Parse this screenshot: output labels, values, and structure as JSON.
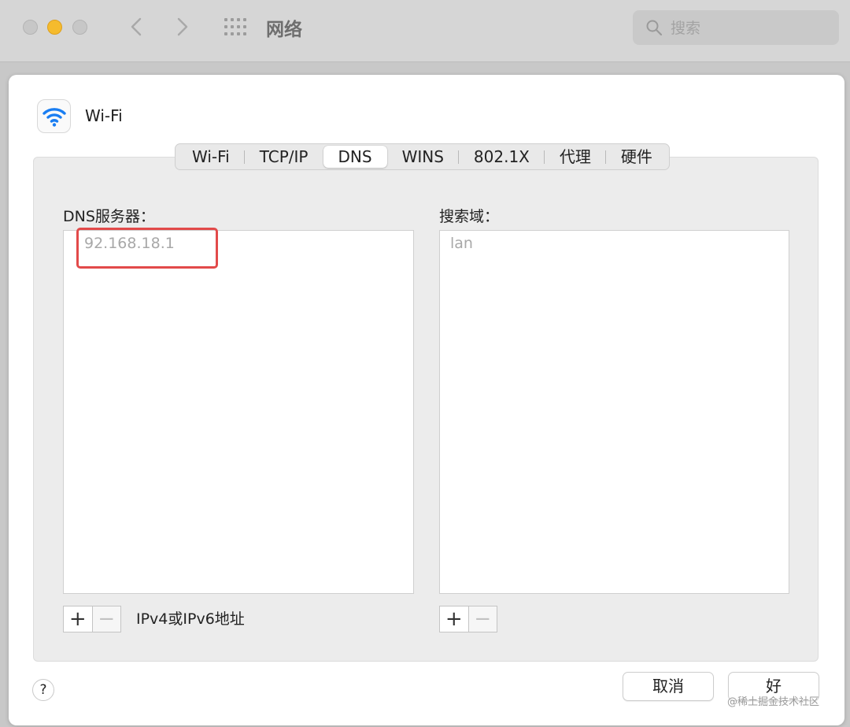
{
  "window": {
    "title": "网络",
    "search_placeholder": "搜索"
  },
  "sheet": {
    "title": "Wi-Fi",
    "tabs": [
      "Wi-Fi",
      "TCP/IP",
      "DNS",
      "WINS",
      "802.1X",
      "代理",
      "硬件"
    ],
    "active_tab": "DNS",
    "dns": {
      "label": "DNS服务器：",
      "entries": [
        "92.168.18.1"
      ],
      "hint": "IPv4或IPv6地址"
    },
    "search_domains": {
      "label": "搜索域：",
      "entries": [
        "lan"
      ]
    },
    "help_label": "?",
    "cancel_label": "取消",
    "ok_label": "好",
    "plus_label": "+",
    "minus_label": "−"
  },
  "watermark": "@稀土掘金技术社区",
  "colors": {
    "highlight": "#e24a4a",
    "wifi_blue": "#1a7ef2",
    "traffic_yellow": "#f5bb2d"
  }
}
